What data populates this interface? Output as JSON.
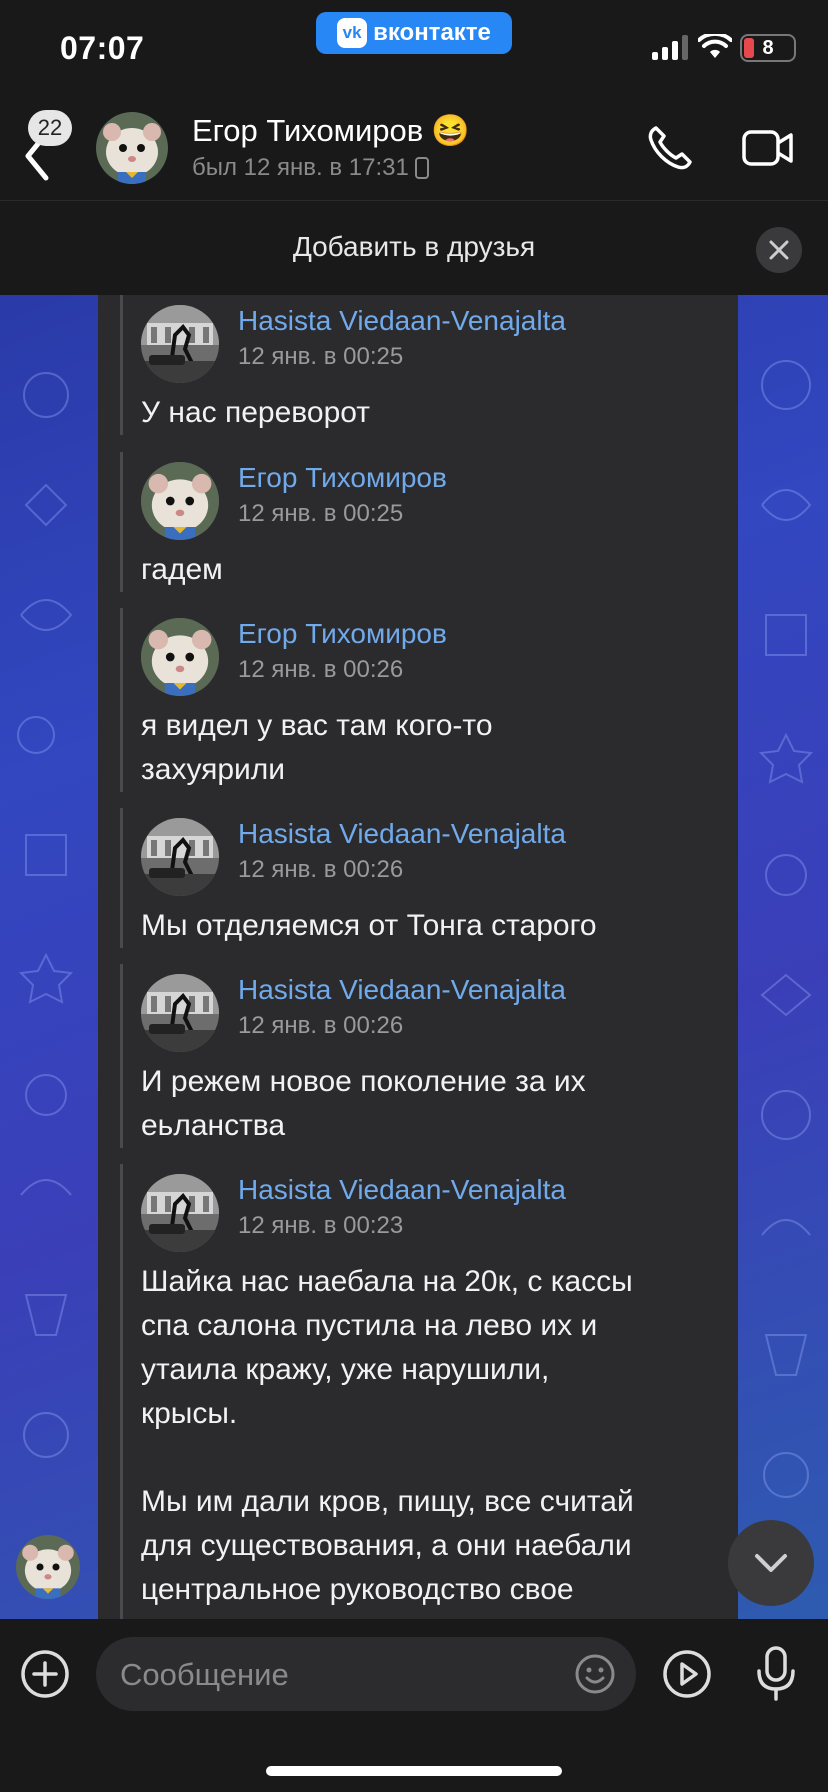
{
  "status": {
    "time": "07:07",
    "app_pill": "вконтакте",
    "battery": "8"
  },
  "header": {
    "back_badge": "22",
    "name": "Егор Тихомиров",
    "name_emoji": "😆",
    "last_seen": "был 12 янв. в 17:31"
  },
  "add_friend": {
    "label": "Добавить в друзья"
  },
  "messages": [
    {
      "author": "Hasista Viedaan-Venajalta",
      "time": "12 янв. в 00:25",
      "text": "У нас переворот",
      "avatar": "horse"
    },
    {
      "author": "Егор Тихомиров",
      "time": "12 янв. в 00:25",
      "text": "гадем",
      "avatar": "hamster"
    },
    {
      "author": "Егор Тихомиров",
      "time": "12 янв. в 00:26",
      "text": "я видел у вас там кого-то\nзахуярили",
      "avatar": "hamster"
    },
    {
      "author": "Hasista Viedaan-Venajalta",
      "time": "12 янв. в 00:26",
      "text": "Мы отделяемся от Тонга старого",
      "avatar": "horse"
    },
    {
      "author": "Hasista Viedaan-Venajalta",
      "time": "12 янв. в 00:26",
      "text": "И режем новое поколение за их\nеьланства",
      "avatar": "horse"
    },
    {
      "author": "Hasista Viedaan-Venajalta",
      "time": "12 янв. в 00:23",
      "text": "Шайка нас наебала на 20к, с кассы\nспа салона пустила на лево их и\nутаила кражу, уже нарушили,\nкрысы.\n\nМы им дали кров, пищу, все считай\nдля существования, а они наебали\nцентральное руководство свое",
      "avatar": "horse"
    }
  ],
  "composer": {
    "placeholder": "Сообщение"
  }
}
